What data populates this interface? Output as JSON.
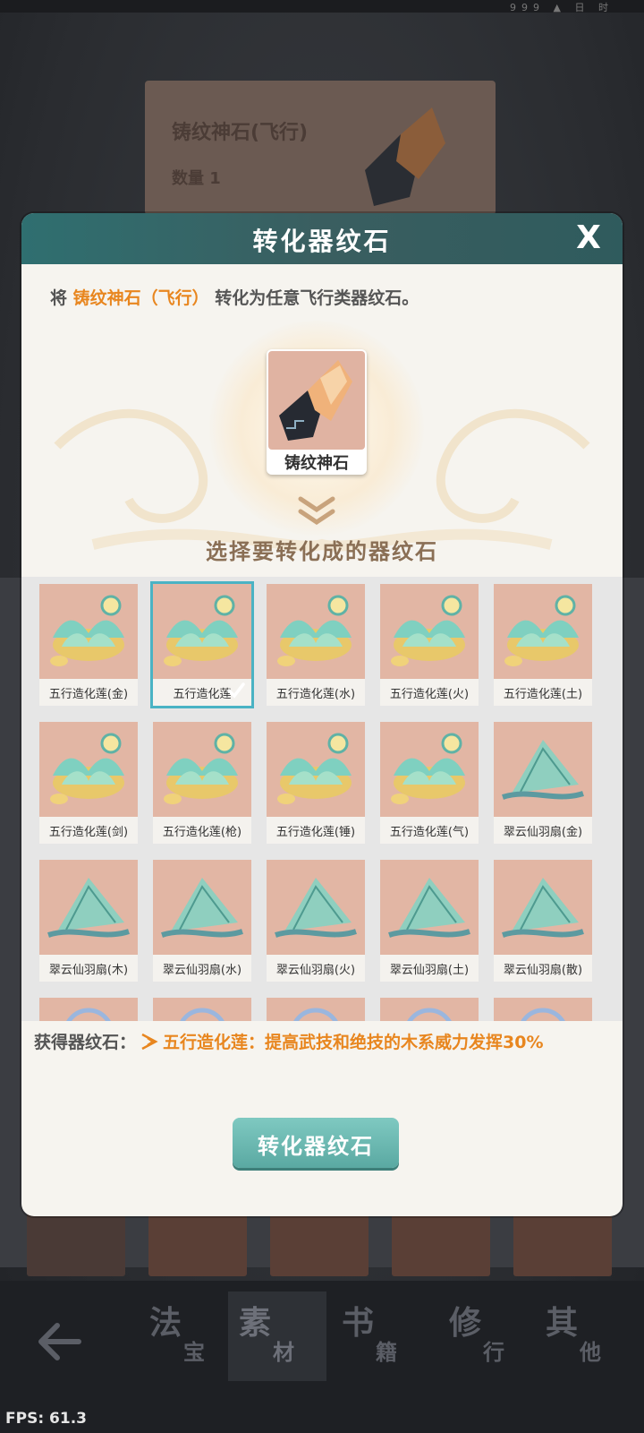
{
  "status": {
    "text": "999 ▲ 日 时"
  },
  "background_card": {
    "title": "铸纹神石(飞行)",
    "quantity": "数量 1"
  },
  "dialog": {
    "title": "转化器纹石",
    "close_label": "X",
    "desc_prefix": "将 ",
    "desc_item": "铸纹神石（飞行）",
    "desc_suffix": " 转化为任意飞行类器纹石。",
    "source_item_label": "铸纹神石",
    "select_label": "选择要转化成的器纹石",
    "grid_items": [
      {
        "label": "五行造化莲(金)",
        "kind": "lotus"
      },
      {
        "label": "五行造化莲",
        "kind": "lotus",
        "selected": true
      },
      {
        "label": "五行造化莲(水)",
        "kind": "lotus"
      },
      {
        "label": "五行造化莲(火)",
        "kind": "lotus"
      },
      {
        "label": "五行造化莲(土)",
        "kind": "lotus"
      },
      {
        "label": "五行造化莲(剑)",
        "kind": "lotus"
      },
      {
        "label": "五行造化莲(枪)",
        "kind": "lotus"
      },
      {
        "label": "五行造化莲(锤)",
        "kind": "lotus"
      },
      {
        "label": "五行造化莲(气)",
        "kind": "lotus"
      },
      {
        "label": "翠云仙羽扇(金)",
        "kind": "fan"
      },
      {
        "label": "翠云仙羽扇(木)",
        "kind": "fan"
      },
      {
        "label": "翠云仙羽扇(水)",
        "kind": "fan"
      },
      {
        "label": "翠云仙羽扇(火)",
        "kind": "fan"
      },
      {
        "label": "翠云仙羽扇(土)",
        "kind": "fan"
      },
      {
        "label": "翠云仙羽扇(散)",
        "kind": "fan"
      },
      {
        "label": "",
        "kind": "ring"
      },
      {
        "label": "",
        "kind": "ring"
      },
      {
        "label": "",
        "kind": "ring"
      },
      {
        "label": "",
        "kind": "ring"
      },
      {
        "label": "",
        "kind": "ring"
      }
    ],
    "result_prefix": "获得器纹石：",
    "result_text": "五行造化莲：提高武技和绝技的木系威力发挥30%",
    "convert_button": "转化器纹石"
  },
  "bottom_nav": {
    "tabs": [
      {
        "main": "法",
        "sub": "宝"
      },
      {
        "main": "素",
        "sub": "材",
        "active": true
      },
      {
        "main": "书",
        "sub": "籍"
      },
      {
        "main": "修",
        "sub": "行"
      },
      {
        "main": "其",
        "sub": "他"
      }
    ]
  },
  "fps": "FPS: 61.3",
  "colors": {
    "accent": "#e8861f",
    "header": "#2f6f70",
    "button": "#5aa9a2",
    "selected_outline": "#4ab3c4"
  }
}
